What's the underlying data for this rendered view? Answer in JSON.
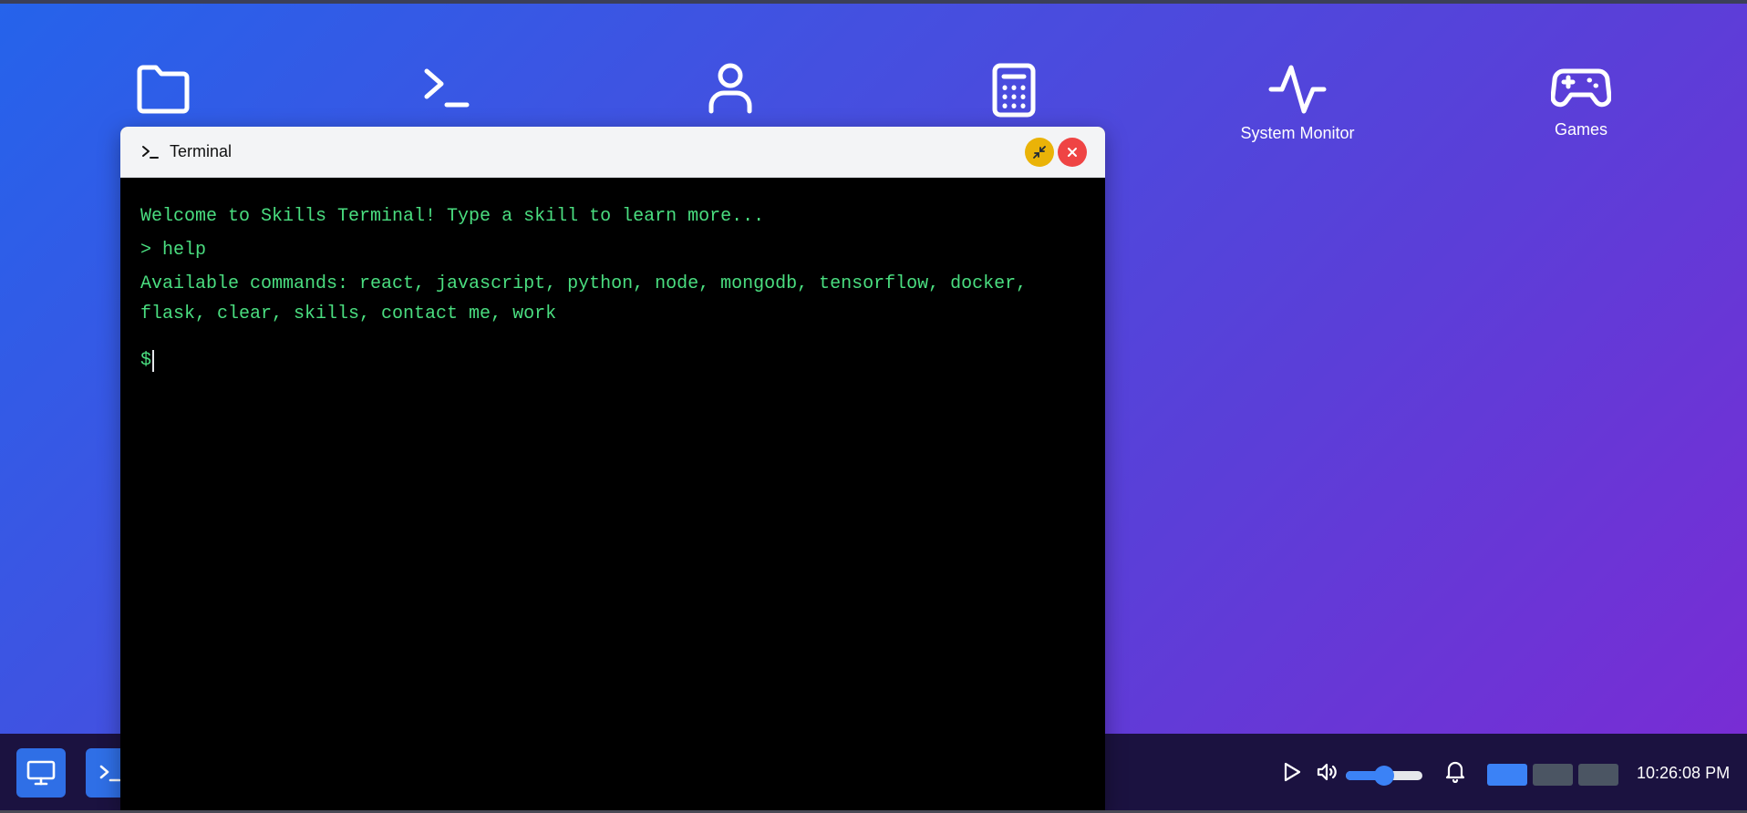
{
  "desktop_icons": [
    {
      "id": "folder",
      "label": "",
      "icon": "folder-icon"
    },
    {
      "id": "terminal",
      "label": "",
      "icon": "terminal-icon"
    },
    {
      "id": "user",
      "label": "",
      "icon": "user-icon"
    },
    {
      "id": "calculator",
      "label": "",
      "icon": "calculator-icon"
    },
    {
      "id": "system-monitor",
      "label": "System Monitor",
      "icon": "activity-icon"
    },
    {
      "id": "games",
      "label": "Games",
      "icon": "gamepad-icon"
    }
  ],
  "terminal_window": {
    "title": "Terminal",
    "lines": [
      "Welcome to Skills Terminal! Type a skill to learn more...",
      "> help",
      "Available commands: react, javascript, python, node, mongodb, tensorflow, docker, flask, clear, skills, contact me, work"
    ],
    "prompt": "$",
    "input_value": ""
  },
  "taskbar": {
    "apps": [
      {
        "name": "desktop",
        "icon": "monitor-icon"
      },
      {
        "name": "terminal",
        "icon": "terminal-icon"
      }
    ],
    "tray": {
      "play_icon": "play-icon",
      "volume_icon": "volume-icon",
      "volume_level": 0.5,
      "bell_icon": "bell-icon"
    },
    "workspaces": [
      {
        "active": true
      },
      {
        "active": false
      },
      {
        "active": false
      }
    ],
    "clock": "10:26:08 PM"
  },
  "colors": {
    "accent": "#3b82f6",
    "terminal_text": "#4ade80",
    "minimize": "#eab308",
    "close": "#ef4444",
    "taskbar_bg": "#1b1240",
    "workspace_inactive": "#4b5563"
  }
}
